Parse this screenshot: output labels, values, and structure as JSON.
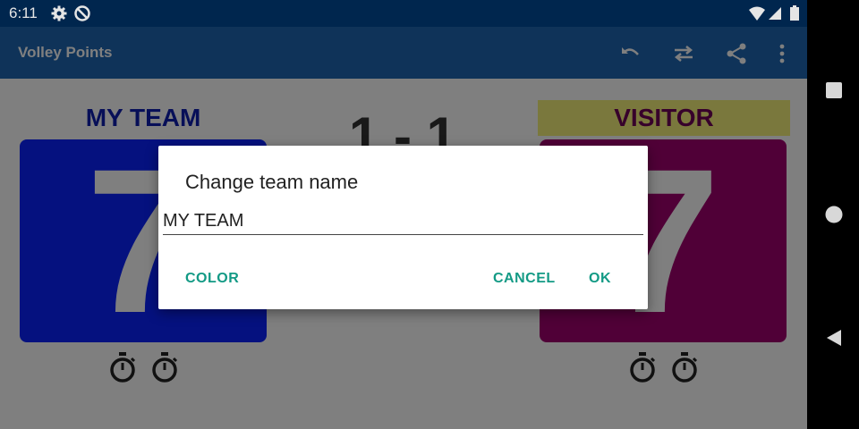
{
  "status_bar": {
    "time": "6:11",
    "icons": [
      "settings-icon",
      "data-saver-icon",
      "wifi-icon",
      "signal-icon",
      "battery-icon"
    ]
  },
  "app_bar": {
    "title": "Volley Points",
    "actions": [
      "undo-icon",
      "swap-icon",
      "share-icon",
      "more-vert-icon"
    ]
  },
  "scoreboard": {
    "home_team": "MY TEAM",
    "visitor_team": "VISITOR",
    "set_score": "1 - 1",
    "home_points": "7",
    "visitor_points": "7",
    "home_color": "#0a23ff",
    "visitor_color": "#a0006e"
  },
  "dialog": {
    "title": "Change team name",
    "field_value": "MY TEAM",
    "color_label": "COLOR",
    "cancel_label": "CANCEL",
    "ok_label": "OK",
    "accent_color": "#139a85"
  },
  "nav_bar": {
    "icons": [
      "recents-icon",
      "home-icon",
      "back-icon"
    ]
  }
}
